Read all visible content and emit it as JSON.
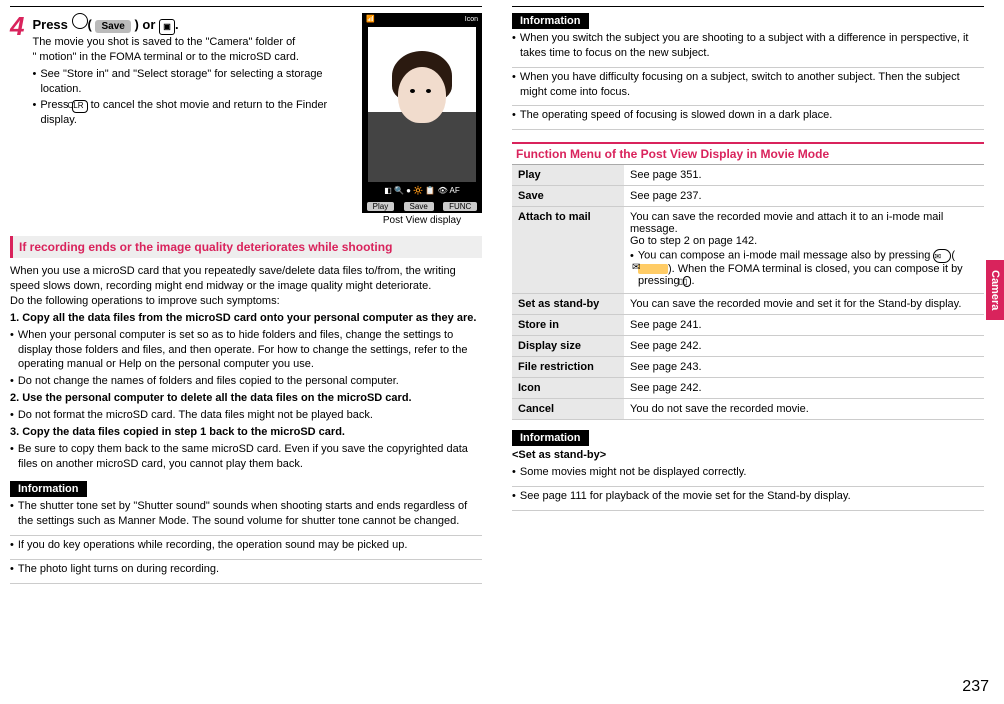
{
  "page_number": "237",
  "side_tab": "Camera",
  "step": {
    "number": "4",
    "head_a": "Press ",
    "head_save": "Save",
    "head_b": " or ",
    "head_c": ".",
    "desc1": "The movie you shot is saved to the \"Camera\" folder of",
    "desc2": "\"   motion\" in the FOMA terminal or to the microSD card.",
    "b1": "See \"Store in\" and \"Select storage\" for selecting a storage location.",
    "b2_a": "Press ",
    "b2_clr": "CLR",
    "b2_b": " to cancel the shot movie and return to the Finder display."
  },
  "post_view_caption": "Post View display",
  "phone": {
    "icon_label": "Icon",
    "sk_play": "Play",
    "sk_save": "Save",
    "sk_func": "FUNC"
  },
  "sec1_title": "If recording ends or the image quality deteriorates while shooting",
  "sec1_p1": "When you use a microSD card that you repeatedly save/delete data files to/from, the writing speed slows down, recording might end midway or the image quality might deteriorate.",
  "sec1_p2": "Do the following operations to improve such symptoms:",
  "sec1_h1": "1. Copy all the data files from the microSD card onto your personal computer as they are.",
  "sec1_b1a": "When your personal computer is set so as to hide folders and files, change the settings to display those folders and files, and then operate. For how to change the settings, refer to the operating manual or Help on the personal computer you use.",
  "sec1_b1b": "Do not change the names of folders and files copied to the personal computer.",
  "sec1_h2": "2. Use the personal computer to delete all the data files on the microSD card.",
  "sec1_b2a": "Do not format the microSD card. The data files might not be played back.",
  "sec1_h3": "3. Copy the data files copied in step 1 back to the microSD card.",
  "sec1_b3a": "Be sure to copy them back to the same microSD card. Even if you save the copyrighted data files on another microSD card, you cannot play them back.",
  "info1_title": "Information",
  "info1_b1": "The shutter tone set by \"Shutter sound\" sounds when shooting starts and ends regardless of the settings such as Manner Mode. The sound volume for shutter tone cannot be changed.",
  "info1_b2": "If you do key operations while recording, the operation sound may be picked up.",
  "info1_b3": "The photo light turns on during recording.",
  "info2_title": "Information",
  "info2_b1": "When you switch the subject you are shooting to a subject with a difference in perspective, it takes time to focus on the new subject.",
  "info2_b2": "When you have difficulty focusing on a subject, switch to another subject. Then the subject might come into focus.",
  "info2_b3": "The operating speed of focusing is slowed down in a dark place.",
  "fm_title": "Function Menu of the Post View Display in Movie Mode",
  "fm": {
    "play_l": "Play",
    "play_v": "See page 351.",
    "save_l": "Save",
    "save_v": "See page 237.",
    "attach_l": "Attach to mail",
    "attach_v1": "You can save the recorded movie and attach it to an i-mode mail message.",
    "attach_v2": "Go to step 2 on page 142.",
    "attach_b1a": "You can compose an i-mode mail message also by pressing ",
    "attach_b1b": ". When the FOMA terminal is closed, you can compose it by pressing ",
    "attach_b1c": ".",
    "standby_l": "Set as stand-by",
    "standby_v": "You can save the recorded movie and set it for the Stand-by display.",
    "store_l": "Store in",
    "store_v": "See page 241.",
    "dispsize_l": "Display size",
    "dispsize_v": "See page 242.",
    "filerest_l": "File restriction",
    "filerest_v": "See page 243.",
    "icon_l": "Icon",
    "icon_v": "See page 242.",
    "cancel_l": "Cancel",
    "cancel_v": "You do not save the recorded movie."
  },
  "info3_title": "Information",
  "info3_h": "<Set as stand-by>",
  "info3_b1": "Some movies might not be displayed correctly.",
  "info3_b2": "See page 111 for playback of the movie set for the Stand-by display."
}
